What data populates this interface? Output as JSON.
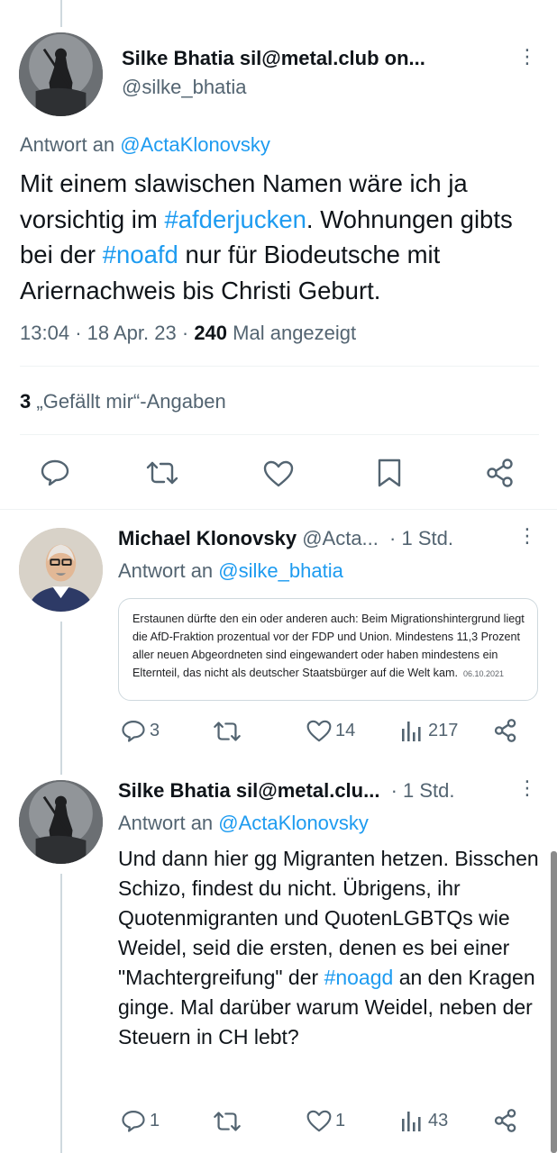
{
  "main_tweet": {
    "author_name": "Silke Bhatia sil@metal.club on...",
    "author_handle": "@silke_bhatia",
    "reply_to_prefix": "Antwort an",
    "reply_to_handle": "@ActaKlonovsky",
    "text_parts": {
      "p1": "Mit einem slawischen Namen wäre ich ja vorsichtig im ",
      "hashtag1": "#afderjucken",
      "p2": ". Wohnungen gibts bei der ",
      "hashtag2": "#noafd",
      "p3": " nur für Biodeutsche mit Ariernachweis bis Christi Geburt."
    },
    "time": "13:04",
    "date": "18 Apr. 23",
    "views_count": "240",
    "views_label": "Mal angezeigt",
    "likes_count": "3",
    "likes_label": "„Gefällt mir“-Angaben",
    "more": "⋮"
  },
  "replies": [
    {
      "author_name": "Michael Klonovsky",
      "author_handle": "@Acta...",
      "time": "· 1 Std.",
      "reply_to_prefix": "Antwort an",
      "reply_to_handle": "@silke_bhatia",
      "quote": {
        "text": "Erstaunen dürfte den ein oder anderen auch: Beim Migrationshintergrund liegt die AfD-Fraktion prozentual vor der FDP und Union. Mindestens 11,3 Prozent aller neuen Abgeordneten sind eingewandert oder haben mindestens ein Elternteil, das nicht als deutscher Staatsbürger auf die Welt kam.",
        "date": "06.10.2021"
      },
      "stats": {
        "replies": "3",
        "retweets": "",
        "likes": "14",
        "views": "217"
      },
      "more": "⋮"
    },
    {
      "author_name": "Silke Bhatia sil@metal.clu...",
      "author_handle": "",
      "time": "· 1 Std.",
      "reply_to_prefix": "Antwort an",
      "reply_to_handle": "@ActaKlonovsky",
      "text_parts": {
        "p1": "Und dann hier gg Migranten hetzen. Bisschen Schizo, findest du nicht. Übrigens,  ihr Quotenmigranten und QuotenLGBTQs wie Weidel, seid die ersten, denen es bei einer \"Machtergreifung\" der ",
        "hashtag": "#noagd",
        "p2": " an den Kragen ginge. Mal darüber warum Weidel, neben der Steuern in CH lebt?"
      },
      "stats": {
        "replies": "1",
        "retweets": "",
        "likes": "1",
        "views": "43"
      },
      "more": "⋮"
    }
  ],
  "icons": {
    "reply": "reply-icon",
    "retweet": "retweet-icon",
    "like": "heart-icon",
    "bookmark": "bookmark-icon",
    "share": "share-icon",
    "views": "views-icon"
  },
  "colors": {
    "link": "#1d9bf0",
    "muted": "#536471",
    "text": "#0f1419"
  }
}
